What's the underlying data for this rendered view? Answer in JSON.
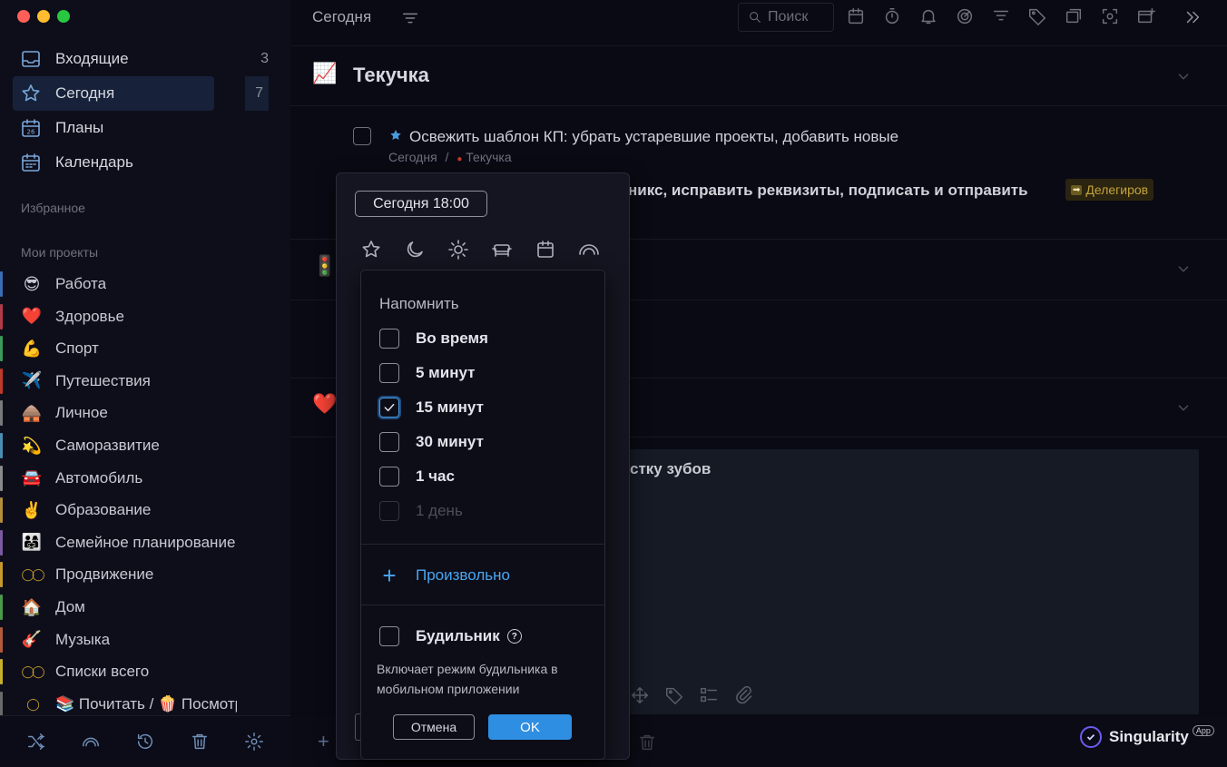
{
  "sidebar": {
    "nav": [
      {
        "label": "Входящие",
        "count": "3",
        "icon": "inbox-icon"
      },
      {
        "label": "Сегодня",
        "count": "7",
        "icon": "star-icon"
      },
      {
        "label": "Планы",
        "count": "",
        "icon": "plans-calendar-icon"
      },
      {
        "label": "Календарь",
        "count": "",
        "icon": "calendar-grid-icon"
      }
    ],
    "favorites_label": "Избранное",
    "projects_label": "Мои проекты",
    "projects": [
      {
        "emoji": "😎",
        "label": "Работа",
        "color": "#3a6db3"
      },
      {
        "emoji": "❤️",
        "label": "Здоровье",
        "color": "#b33a4a"
      },
      {
        "emoji": "💪",
        "label": "Спорт",
        "color": "#3a9b5a"
      },
      {
        "emoji": "✈️",
        "label": "Путешествия",
        "color": "#c0392b"
      },
      {
        "emoji": "🛖",
        "label": "Личное",
        "color": "#7a7a7a"
      },
      {
        "emoji": "💫",
        "label": "Саморазвитие",
        "color": "#4a8fb3"
      },
      {
        "emoji": "🚘",
        "label": "Автомобиль",
        "color": "#8a8a8a"
      },
      {
        "emoji": "✌️",
        "label": "Образование",
        "color": "#b38f3a"
      },
      {
        "emoji": "👨‍👩‍👧",
        "label": "Семейное планирование",
        "color": "#7a5aa0"
      },
      {
        "emoji": "◯◯",
        "label": "Продвижение",
        "color": "#c79a2a"
      },
      {
        "emoji": "🏠",
        "label": "Дом",
        "color": "#4a9b4a"
      },
      {
        "emoji": "🎸",
        "label": "Музыка",
        "color": "#b35a3a"
      },
      {
        "emoji": "◯◯",
        "label": "Списки всего",
        "color": "#c7b02a"
      },
      {
        "emoji": "◯",
        "label": "📚 Почитать / 🍿 Посмотреть",
        "color": "#6a6a6a"
      }
    ]
  },
  "topbar": {
    "title": "Сегодня",
    "search_placeholder": "Поиск"
  },
  "groups": {
    "g1_emoji": "📈",
    "g1_title": "Текучка",
    "g2_emoji": "🚦",
    "g3_emoji": "❤️"
  },
  "tasks": {
    "t1_title": "Освежить шаблон КП: убрать устаревшие проекты, добавить новые",
    "t1_meta_date": "Сегодня",
    "t1_meta_sep": "/",
    "t1_meta_project": "Текучка",
    "t2_title_visible": "никс, исправить реквизиты, подписать и отправить",
    "t2_badge": "Делегиров",
    "t3_title_visible": "стку зубов"
  },
  "date_popup": {
    "date_value": "Сегодня 18:00"
  },
  "remind": {
    "header": "Напомнить",
    "options": [
      {
        "label": "Во время",
        "checked": false,
        "disabled": false
      },
      {
        "label": "5 минут",
        "checked": false,
        "disabled": false
      },
      {
        "label": "15 минут",
        "checked": true,
        "disabled": false
      },
      {
        "label": "30 минут",
        "checked": false,
        "disabled": false
      },
      {
        "label": "1 час",
        "checked": false,
        "disabled": false
      },
      {
        "label": "1 день",
        "checked": false,
        "disabled": true
      }
    ],
    "custom_label": "Произвольно",
    "alarm_label": "Будильник",
    "alarm_help": "?",
    "alarm_desc": "Включает режим будильника в мобильном приложении",
    "cancel_label": "Отмена",
    "ok_label": "OK"
  },
  "brand": {
    "name": "Singularity",
    "tag": "App"
  },
  "colors": {
    "accent": "#2e8ee2",
    "link": "#4aa6f0",
    "star": "#4a9be0",
    "badge": "#c5a33a"
  }
}
